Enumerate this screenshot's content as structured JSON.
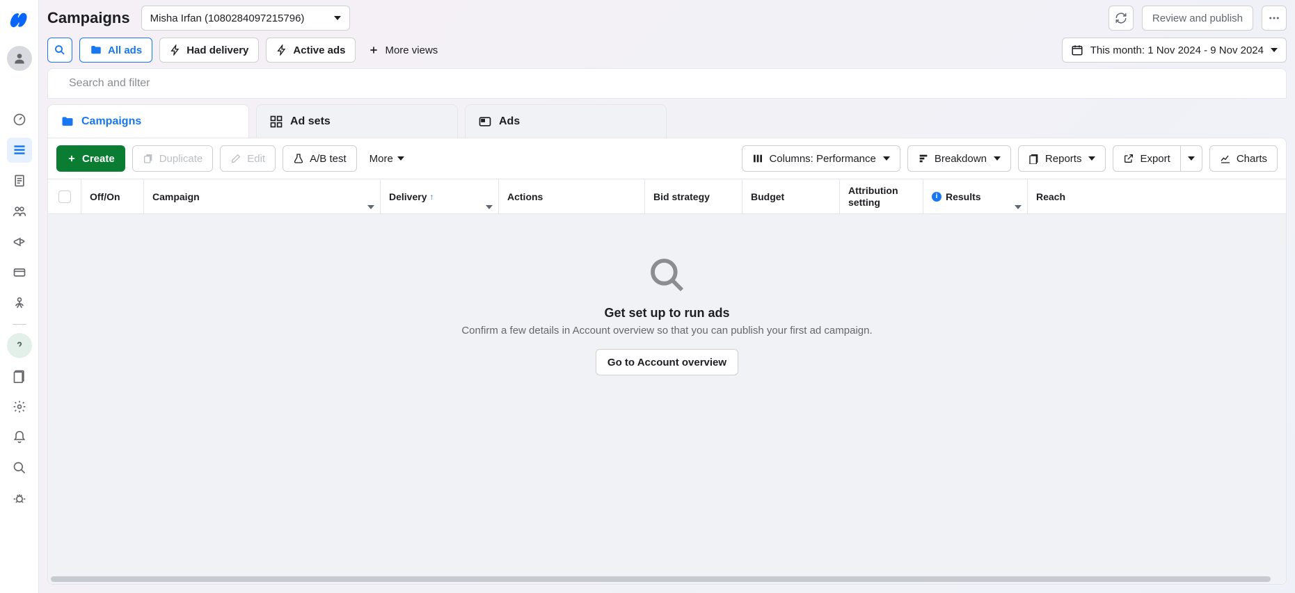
{
  "header": {
    "title": "Campaigns",
    "account": "Misha Irfan (1080284097215796)",
    "review_publish": "Review and publish"
  },
  "filters": {
    "all_ads": "All ads",
    "had_delivery": "Had delivery",
    "active_ads": "Active ads",
    "more_views": "More views",
    "date_range": "This month: 1 Nov 2024 - 9 Nov 2024"
  },
  "search_placeholder": "Search and filter",
  "tabs": {
    "campaigns": "Campaigns",
    "adsets": "Ad sets",
    "ads": "Ads"
  },
  "toolbar": {
    "create": "Create",
    "duplicate": "Duplicate",
    "edit": "Edit",
    "abtest": "A/B test",
    "more": "More",
    "columns": "Columns: Performance",
    "breakdown": "Breakdown",
    "reports": "Reports",
    "export": "Export",
    "charts": "Charts"
  },
  "columns": {
    "onoff": "Off/On",
    "campaign": "Campaign",
    "delivery": "Delivery",
    "actions": "Actions",
    "bid": "Bid strategy",
    "budget": "Budget",
    "attribution": "Attribution setting",
    "results": "Results",
    "reach": "Reach"
  },
  "empty": {
    "title": "Get set up to run ads",
    "subtitle": "Confirm a few details in Account overview so that you can publish your first ad campaign.",
    "button": "Go to Account overview"
  }
}
